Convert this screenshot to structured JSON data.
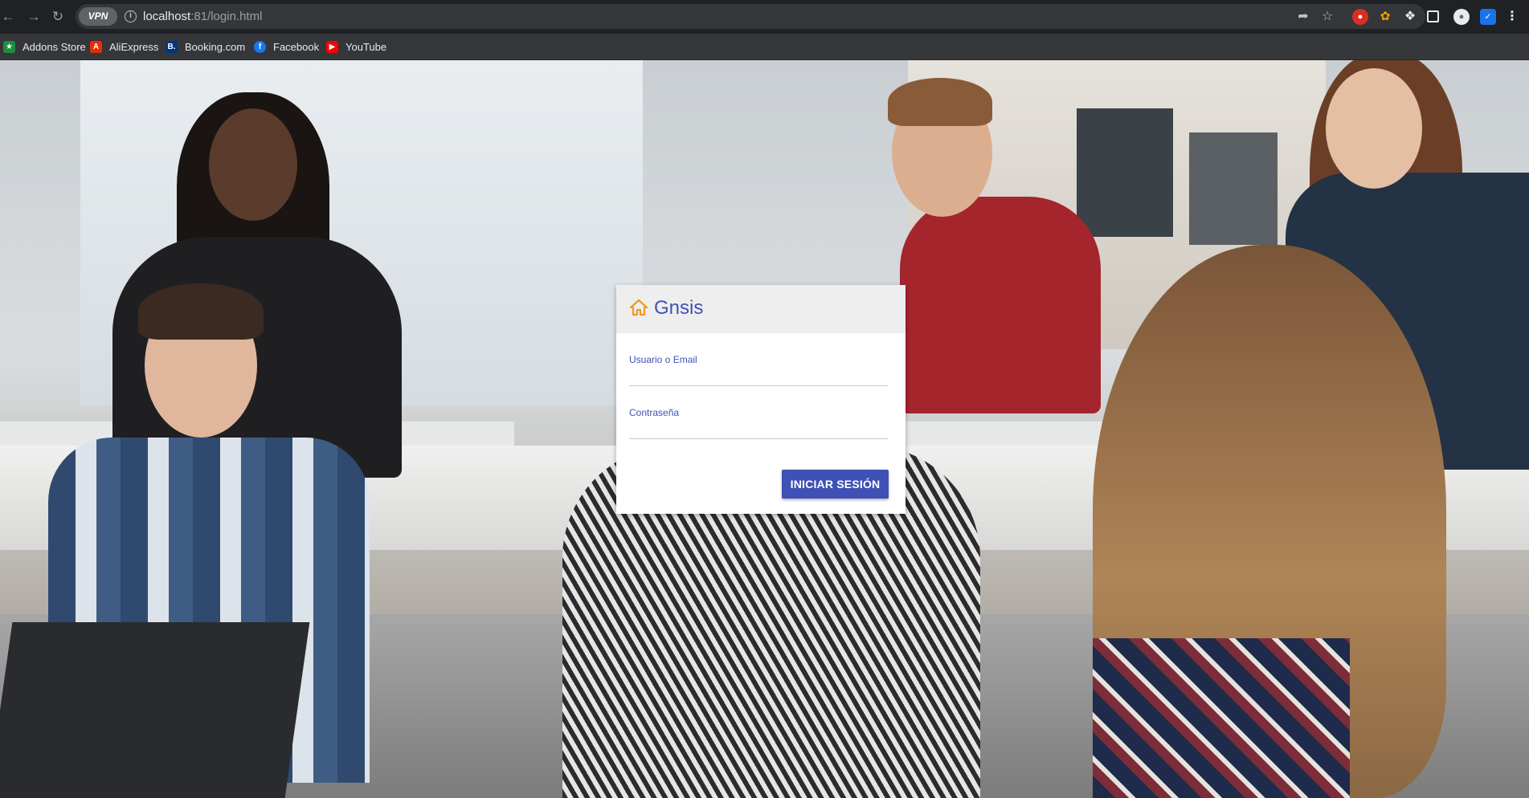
{
  "browser": {
    "vpn_label": "VPN",
    "url_host": "localhost",
    "url_path": ":81/login.html"
  },
  "bookmarks": [
    {
      "label": "Addons Store",
      "icon": "addons-store-icon",
      "color": "#1e8e3e"
    },
    {
      "label": "AliExpress",
      "icon": "aliexpress-icon",
      "color": "#e62e04"
    },
    {
      "label": "Booking.com",
      "icon": "booking-icon",
      "color": "#003580"
    },
    {
      "label": "Facebook",
      "icon": "facebook-icon",
      "color": "#1877f2"
    },
    {
      "label": "YouTube",
      "icon": "youtube-icon",
      "color": "#ff0000"
    }
  ],
  "login": {
    "brand": "Gnsis",
    "username_label": "Usuario o Email",
    "username_value": "",
    "password_label": "Contraseña",
    "password_value": "",
    "submit_label": "INICIAR SESIÓN",
    "accent_color": "#3f51b5",
    "icon_color": "#f39a1e"
  }
}
